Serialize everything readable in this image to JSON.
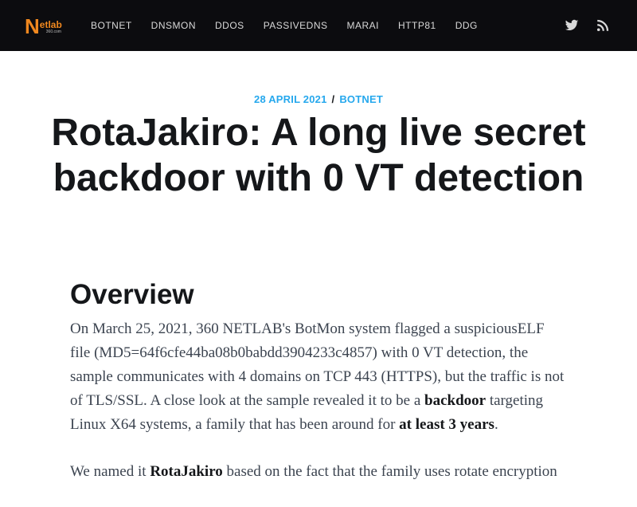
{
  "header": {
    "logo_mark": "N",
    "logo_word": "etlab",
    "logo_sub": "360.com",
    "nav": [
      "BOTNET",
      "DNSMON",
      "DDOS",
      "PASSIVEDNS",
      "MARAI",
      "HTTP81",
      "DDG"
    ],
    "social_icons": [
      "twitter-icon",
      "rss-icon"
    ]
  },
  "post": {
    "date": "28 APRIL 2021",
    "separator": "/",
    "tag": "BOTNET",
    "title": "RotaJakiro: A long live secret backdoor with 0 VT detection"
  },
  "article": {
    "heading": "Overview",
    "p1": {
      "a": "On March 25, 2021, 360 NETLAB's BotMon system flagged a suspiciousELF file (MD5=64f6cfe44ba08b0babdd3904233c4857) with 0 VT detection, the sample communicates with 4 domains on TCP 443 (HTTPS), but the traffic is not of TLS/SSL. A close look at the sample revealed it to be a ",
      "b1": "backdoor",
      "c": " targeting Linux X64 systems, a family that has been around for ",
      "b2": "at least 3 years",
      "d": "."
    },
    "p2": {
      "a": "We named it ",
      "b1": "RotaJakiro",
      "c": " based on the fact that the family uses rotate encryption"
    }
  },
  "colors": {
    "topbar": "#0c0c0f",
    "accent": "#26a8ed",
    "logo": "#f0881f"
  }
}
